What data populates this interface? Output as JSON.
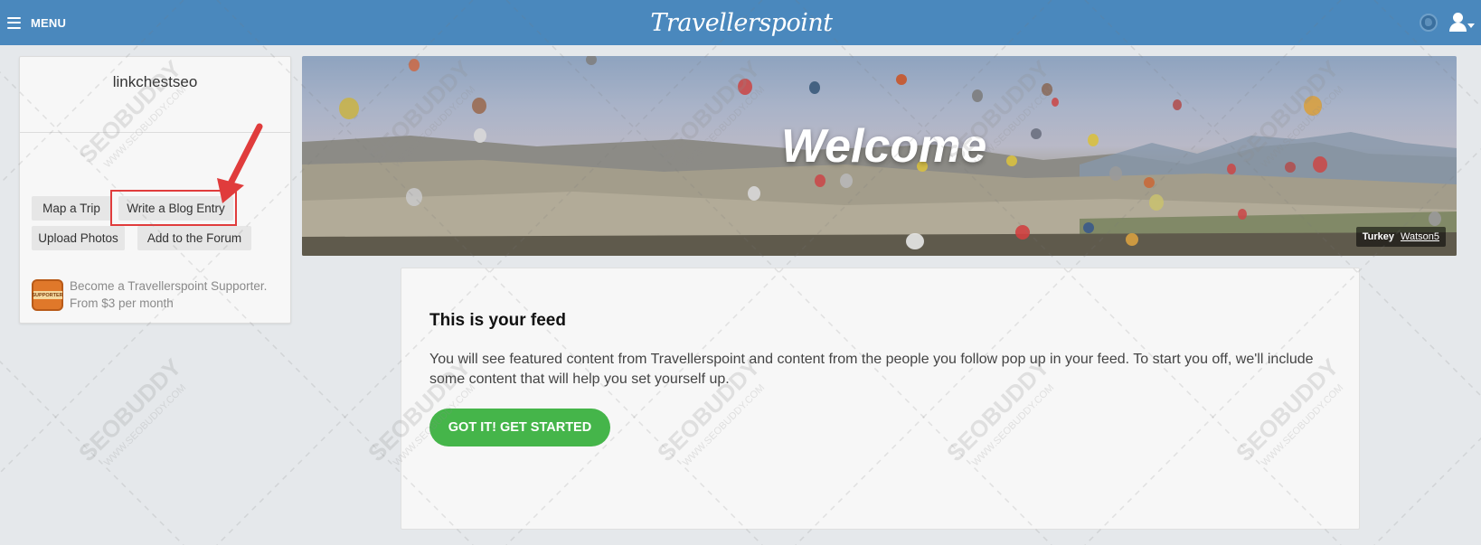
{
  "topbar": {
    "menu_label": "MENU",
    "logo_text": "Travellerspoint",
    "bg_color": "#4a88bd"
  },
  "sidebar": {
    "username": "linkchestseo",
    "actions": [
      {
        "label": "Map a Trip"
      },
      {
        "label": "Write a Blog Entry"
      },
      {
        "label": "Upload Photos"
      },
      {
        "label": "Add to the Forum"
      }
    ],
    "supporter": {
      "badge_text": "SUPPORTER",
      "line1": "Become a Travellerspoint Supporter.",
      "line2": "From $3 per month"
    }
  },
  "banner": {
    "heading": "Welcome",
    "photo_location": "Turkey",
    "photo_author": "Watson5"
  },
  "feed": {
    "title": "This is your feed",
    "body": "You will see featured content from Travellerspoint and content from the people you follow pop up in your feed. To start you off, we'll include some content that will help you set yourself up.",
    "cta_label": "GOT IT! GET STARTED",
    "cta_color": "#45b54a"
  },
  "watermark": {
    "brand": "SEOBUDDY",
    "url": "WWW.SEOBUDDY.COM"
  },
  "annotation": {
    "highlight_color": "#e03c3c",
    "highlighted_item": "Write a Blog Entry"
  }
}
